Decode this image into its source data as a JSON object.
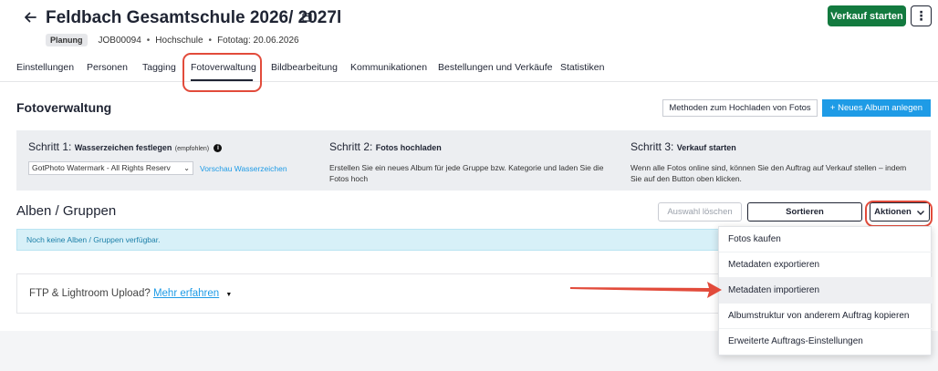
{
  "header": {
    "title": "Feldbach Gesamtschule 2026/ 2027l",
    "status_badge": "Planung",
    "job_id": "JOB00094",
    "school_type": "Hochschule",
    "photo_day": "Fototag: 20.06.2026",
    "start_sale_label": "Verkauf starten",
    "more_label": "⋮",
    "back_icon": "arrow-left-icon",
    "calendar_icon": "calendar-edit-icon"
  },
  "tabs": [
    {
      "label": "Einstellungen"
    },
    {
      "label": "Personen"
    },
    {
      "label": "Tagging"
    },
    {
      "label": "Fotoverwaltung",
      "active": true
    },
    {
      "label": "Bildbearbeitung"
    },
    {
      "label": "Kommunikationen"
    },
    {
      "label": "Bestellungen und Verkäufe"
    },
    {
      "label": "Statistiken"
    }
  ],
  "section": {
    "title": "Fotoverwaltung",
    "upload_methods_label": "Methoden zum Hochladen von Fotos",
    "new_album_label": "+  Neues Album anlegen"
  },
  "steps": {
    "step1": {
      "prefix": "Schritt 1:",
      "title": "Wasserzeichen festlegen",
      "note": "(empfohlen)",
      "watermark_value": "GotPhoto Watermark - All Rights Reserv",
      "preview_link": "Vorschau Wasserzeichen"
    },
    "step2": {
      "prefix": "Schritt 2:",
      "title": "Fotos hochladen",
      "text": "Erstellen Sie ein neues Album für jede Gruppe bzw. Kategorie und laden Sie die Fotos hoch"
    },
    "step3": {
      "prefix": "Schritt 3:",
      "title": "Verkauf starten",
      "text": "Wenn alle Fotos online sind, können Sie den Auftrag auf Verkauf stellen – indem Sie auf den Button oben klicken."
    }
  },
  "albums": {
    "title": "Alben / Gruppen",
    "clear_selection_label": "Auswahl löschen",
    "sort_label": "Sortieren",
    "actions_label": "Aktionen",
    "empty_message": "Noch keine Alben / Gruppen verfügbar."
  },
  "ftp": {
    "question": "FTP & Lightroom Upload?",
    "link": "Mehr erfahren"
  },
  "actions_menu": {
    "items": [
      "Fotos kaufen",
      "Metadaten exportieren",
      "Metadaten importieren",
      "Albumstruktur von anderem Auftrag kopieren",
      "Erweiterte Auftrags-Einstellungen"
    ],
    "hovered_index": 2
  },
  "colors": {
    "primary_green": "#137a3f",
    "accent_blue": "#1e9be6",
    "highlight_red": "#e24b3b",
    "info_banner": "#d7f0f8"
  }
}
